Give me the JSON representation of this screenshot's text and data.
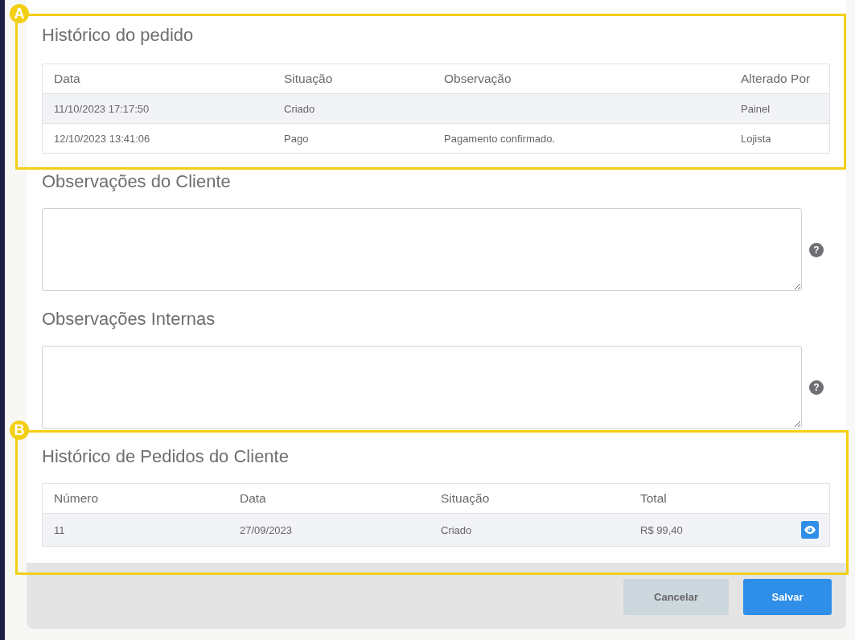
{
  "order_history": {
    "title": "Histórico do pedido",
    "columns": [
      "Data",
      "Situação",
      "Observação",
      "Alterado Por"
    ],
    "rows": [
      [
        "11/10/2023 17:17:50",
        "Criado",
        "",
        "Painel"
      ],
      [
        "12/10/2023 13:41:06",
        "Pago",
        "Pagamento confirmado.",
        "Lojista"
      ]
    ]
  },
  "notes": [
    {
      "title": "Observações do Cliente",
      "help_icon": "?"
    },
    {
      "title": "Observações Internas",
      "help_icon": "?"
    }
  ],
  "customer_orders": {
    "title": "Histórico de Pedidos do Cliente",
    "columns": [
      "Número",
      "Data",
      "Situação",
      "Total"
    ],
    "rows": [
      [
        "11",
        "27/09/2023",
        "Criado",
        "R$ 99,40"
      ]
    ]
  },
  "buttons": [
    {
      "label": "Cancelar",
      "kind": "secondary"
    },
    {
      "label": "Salvar",
      "kind": "primary"
    }
  ],
  "annotations": [
    {
      "label": "A"
    },
    {
      "label": "B"
    }
  ]
}
